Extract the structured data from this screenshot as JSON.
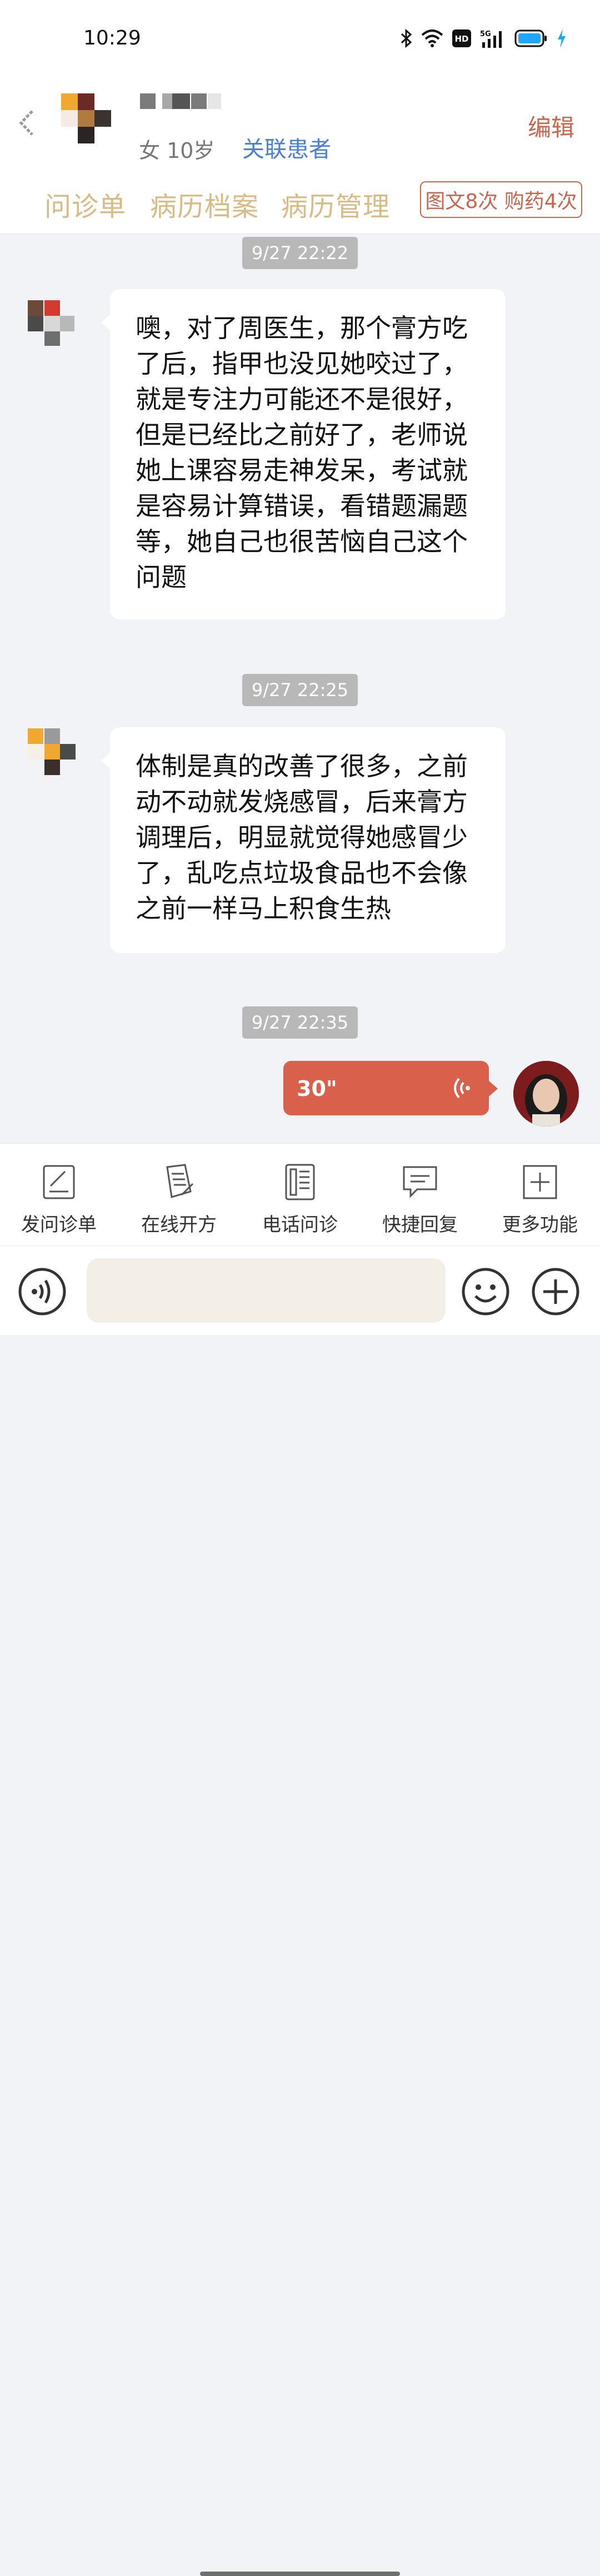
{
  "status_bar": {
    "time": "10:29",
    "icons": [
      "bluetooth-icon",
      "wifi-icon",
      "hd-icon",
      "signal-5g-icon",
      "battery-icon",
      "charging-icon"
    ],
    "hd_label": "HD",
    "network_label": "5G"
  },
  "header": {
    "patient_info": "女 10岁",
    "link_patient": "关联患者",
    "edit": "编辑",
    "tabs": [
      {
        "label": "问诊单"
      },
      {
        "label": "病历档案"
      },
      {
        "label": "病历管理"
      }
    ],
    "quota": "图文8次 购药4次"
  },
  "conversation": {
    "timestamps": [
      "9/27 22:22",
      "9/27 22:25",
      "9/27 22:35"
    ],
    "messages": [
      {
        "text": "噢，对了周医生，那个膏方吃了后，指甲也没见她咬过了，就是专注力可能还不是很好，但是已经比之前好了，老师说她上课容易走神发呆，考试就是容易计算错误，看错题漏题等，她自己也很苦恼自己这个问题"
      },
      {
        "text": "体制是真的改善了很多，之前动不动就发烧感冒，后来膏方调理后，明显就觉得她感冒少了，乱吃点垃圾食品也不会像之前一样马上积食生热"
      }
    ],
    "voice_message": {
      "duration": "30\""
    }
  },
  "toolbar": {
    "items": [
      {
        "label": "发问诊单",
        "icon": "form-icon"
      },
      {
        "label": "在线开方",
        "icon": "prescription-icon"
      },
      {
        "label": "电话问诊",
        "icon": "phone-icon"
      },
      {
        "label": "快捷回复",
        "icon": "quick-reply-icon"
      },
      {
        "label": "更多功能",
        "icon": "more-icon"
      }
    ]
  },
  "colors": {
    "accent": "#c8664e",
    "tab_text": "#d8bb85",
    "link": "#4a7fd1",
    "voice_bubble": "#d9604b",
    "background": "#f2f3f7"
  }
}
